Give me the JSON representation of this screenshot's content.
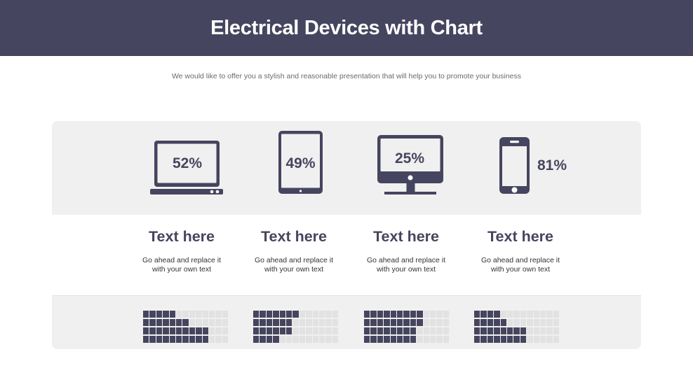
{
  "header": {
    "title": "Electrical Devices with Chart"
  },
  "subtitle": "We would like to offer you a stylish and reasonable presentation that will help you to promote your business",
  "colors": {
    "primary": "#46455f",
    "panel": "#f0f0f0",
    "empty_cell": "#e2e2e3",
    "body_text": "#333333",
    "subtitle_text": "#6a6a6a"
  },
  "devices": [
    {
      "icon": "laptop-icon",
      "percent_label": "52%",
      "title": "Text here",
      "desc_line1": "Go ahead and replace it",
      "desc_line2": "with your own text"
    },
    {
      "icon": "tablet-icon",
      "percent_label": "49%",
      "title": "Text here",
      "desc_line1": "Go ahead and replace it",
      "desc_line2": "with your own text"
    },
    {
      "icon": "monitor-icon",
      "percent_label": "25%",
      "title": "Text here",
      "desc_line1": "Go ahead and replace it",
      "desc_line2": "with your own text"
    },
    {
      "icon": "smartphone-icon",
      "percent_label": "81%",
      "title": "Text here",
      "desc_line1": "Go ahead and replace it",
      "desc_line2": "with your own text"
    }
  ],
  "chart_data": {
    "type": "heatmap",
    "title": "Electrical Devices with Chart",
    "categories": [
      "laptop",
      "tablet",
      "monitor",
      "smartphone"
    ],
    "values": [
      52,
      49,
      25,
      81
    ],
    "unit": "%",
    "xlabel": "",
    "ylabel": "",
    "legend": "none",
    "grid": false,
    "waffle": {
      "rows": 4,
      "cols": 13,
      "filled_per_row": [
        [
          5,
          7,
          10,
          10
        ],
        [
          7,
          6,
          6,
          4
        ],
        [
          9,
          9,
          8,
          8
        ],
        [
          4,
          5,
          8,
          8
        ]
      ]
    }
  }
}
